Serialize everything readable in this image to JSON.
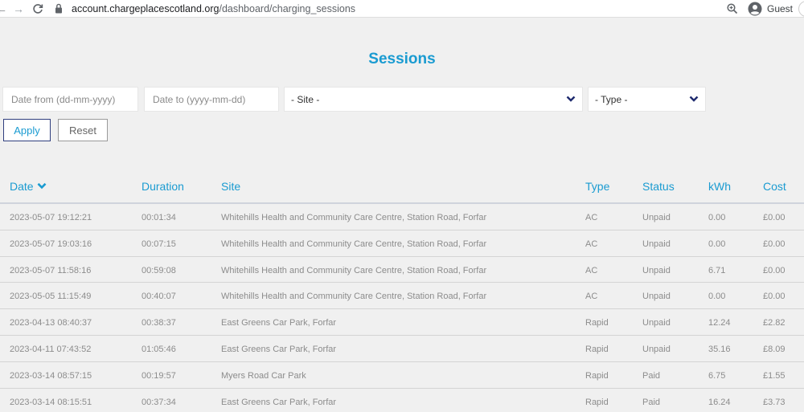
{
  "browser": {
    "nav_back": "←",
    "nav_forward": "→",
    "reload": "C",
    "url_host": "account.chargeplacescotland.org",
    "url_path": "/dashboard/charging_sessions",
    "profile_label": "Guest"
  },
  "page": {
    "title": "Sessions"
  },
  "filters": {
    "date_from_placeholder": "Date from (dd-mm-yyyy)",
    "date_to_placeholder": "Date to (yyyy-mm-dd)",
    "site_selected": "- Site -",
    "type_selected": "- Type -",
    "apply_label": "Apply",
    "reset_label": "Reset"
  },
  "table": {
    "columns": [
      "Date",
      "Duration",
      "Site",
      "Type",
      "Status",
      "kWh",
      "Cost"
    ],
    "rows": [
      [
        "2023-05-07 19:12:21",
        "00:01:34",
        "Whitehills Health and Community Care Centre, Station Road, Forfar",
        "AC",
        "Unpaid",
        "0.00",
        "£0.00"
      ],
      [
        "2023-05-07 19:03:16",
        "00:07:15",
        "Whitehills Health and Community Care Centre, Station Road, Forfar",
        "AC",
        "Unpaid",
        "0.00",
        "£0.00"
      ],
      [
        "2023-05-07 11:58:16",
        "00:59:08",
        "Whitehills Health and Community Care Centre, Station Road, Forfar",
        "AC",
        "Unpaid",
        "6.71",
        "£0.00"
      ],
      [
        "2023-05-05 11:15:49",
        "00:40:07",
        "Whitehills Health and Community Care Centre, Station Road, Forfar",
        "AC",
        "Unpaid",
        "0.00",
        "£0.00"
      ],
      [
        "2023-04-13 08:40:37",
        "00:38:37",
        "East Greens Car Park, Forfar",
        "Rapid",
        "Unpaid",
        "12.24",
        "£2.82"
      ],
      [
        "2023-04-11 07:43:52",
        "01:05:46",
        "East Greens Car Park, Forfar",
        "Rapid",
        "Unpaid",
        "35.16",
        "£8.09"
      ],
      [
        "2023-03-14 08:57:15",
        "00:19:57",
        "Myers Road Car Park",
        "Rapid",
        "Paid",
        "6.75",
        "£1.55"
      ],
      [
        "2023-03-14 08:15:51",
        "00:37:34",
        "East Greens Car Park, Forfar",
        "Rapid",
        "Paid",
        "16.24",
        "£3.73"
      ]
    ]
  },
  "colors": {
    "accent": "#1a9bd1",
    "navy": "#1e2a6e",
    "muted_text": "#8c8c8c",
    "background": "#f0f0f0"
  }
}
